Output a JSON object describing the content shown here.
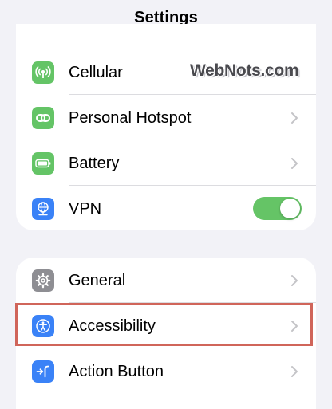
{
  "nav": {
    "title": "Settings"
  },
  "watermark": "WebNots.com",
  "colors": {
    "background": "#f2f2f7",
    "cellular_icon_bg": "#64c466",
    "hotspot_icon_bg": "#64c466",
    "battery_icon_bg": "#64c466",
    "vpn_icon_bg": "#3a82f7",
    "general_icon_bg": "#8e8e93",
    "accessibility_icon_bg": "#3a82f7",
    "action_button_icon_bg": "#3a82f7",
    "toggle_on": "#65c466",
    "highlight_border": "#d0655a"
  },
  "group1": {
    "items": [
      {
        "label": "Cellular",
        "icon": "antenna-icon",
        "accessory": "none"
      },
      {
        "label": "Personal Hotspot",
        "icon": "link-icon",
        "accessory": "chevron"
      },
      {
        "label": "Battery",
        "icon": "battery-icon",
        "accessory": "chevron"
      },
      {
        "label": "VPN",
        "icon": "globe-network-icon",
        "accessory": "toggle",
        "toggle_on": true
      }
    ]
  },
  "group2": {
    "items": [
      {
        "label": "General",
        "icon": "gear-icon",
        "accessory": "chevron"
      },
      {
        "label": "Accessibility",
        "icon": "accessibility-icon",
        "accessory": "chevron",
        "highlighted": true
      },
      {
        "label": "Action Button",
        "icon": "action-button-icon",
        "accessory": "chevron"
      }
    ]
  }
}
